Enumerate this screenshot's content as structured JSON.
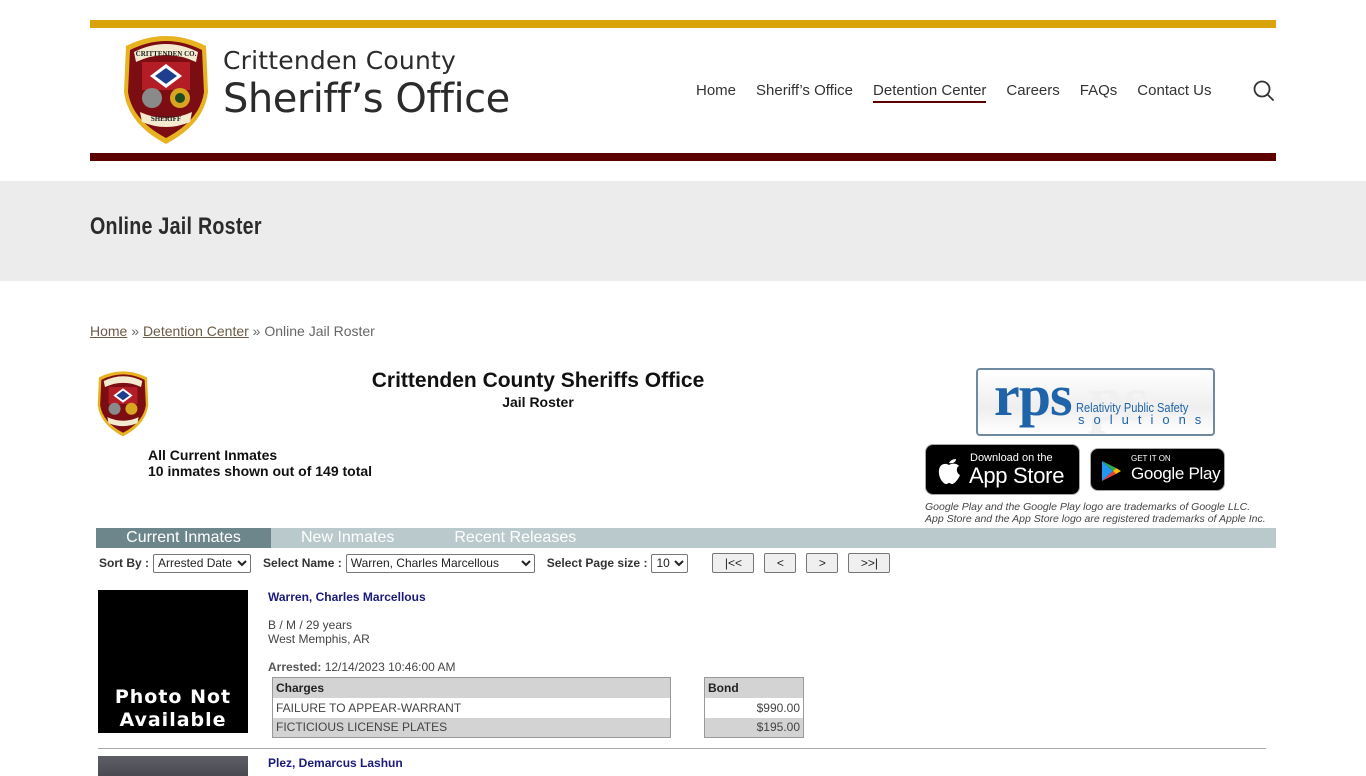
{
  "header": {
    "brand_line1": "Crittenden County",
    "brand_line2": "Sheriff’s Office",
    "nav": [
      {
        "label": "Home",
        "active": false
      },
      {
        "label": "Sheriff’s Office",
        "active": false
      },
      {
        "label": "Detention Center",
        "active": true
      },
      {
        "label": "Careers",
        "active": false
      },
      {
        "label": "FAQs",
        "active": false
      },
      {
        "label": "Contact Us",
        "active": false
      }
    ],
    "search_icon": "search-icon",
    "colors": {
      "gold": "#d9a40b",
      "maroon": "#5c0000"
    }
  },
  "page": {
    "title": "Online Jail Roster",
    "breadcrumb": {
      "home": "Home",
      "sep": "»",
      "parent": "Detention Center",
      "current": "Online Jail Roster"
    }
  },
  "roster": {
    "title": "Crittenden County Sheriffs Office",
    "subtitle": "Jail Roster",
    "filter_label": "All Current Inmates",
    "count_text": "10 inmates shown out of 149 total",
    "rps": {
      "big": "rps",
      "line1": "Relativity Public Safety",
      "line2": "solutions"
    },
    "appstore": {
      "small": "Download on the",
      "big": "App Store"
    },
    "googleplay": {
      "small": "GET IT ON",
      "big": "Google Play"
    },
    "trademark_line1": "Google Play and the Google Play logo are trademarks of Google LLC.",
    "trademark_line2": "App Store and the App Store logo are registered trademarks of Apple Inc.",
    "tabs": [
      {
        "label": "Current Inmates",
        "active": true
      },
      {
        "label": "New Inmates",
        "active": false
      },
      {
        "label": "Recent Releases",
        "active": false
      }
    ],
    "controls": {
      "sort_label": "Sort By :",
      "sort_value": "Arrested Date",
      "name_label": "Select Name :",
      "name_value": "Warren, Charles Marcellous",
      "pagesize_label": "Select Page size :",
      "pagesize_value": "10",
      "first": "|<<",
      "prev": "<",
      "next": ">",
      "last": ">>|"
    },
    "inmates": [
      {
        "name": "Warren, Charles Marcellous",
        "demographics": "B / M / 29 years",
        "location": "West Memphis, AR",
        "arrested_label": "Arrested:",
        "arrested": "12/14/2023 10:46:00 AM",
        "photo_text_1": "Photo Not",
        "photo_text_2": "Available",
        "charges_header": "Charges",
        "bond_header": "Bond",
        "charges": [
          {
            "charge": "FAILURE TO APPEAR-WARRANT",
            "bond": "$990.00"
          },
          {
            "charge": "FICTICIOUS LICENSE PLATES",
            "bond": "$195.00"
          }
        ]
      },
      {
        "name": "Plez, Demarcus Lashun"
      }
    ]
  }
}
